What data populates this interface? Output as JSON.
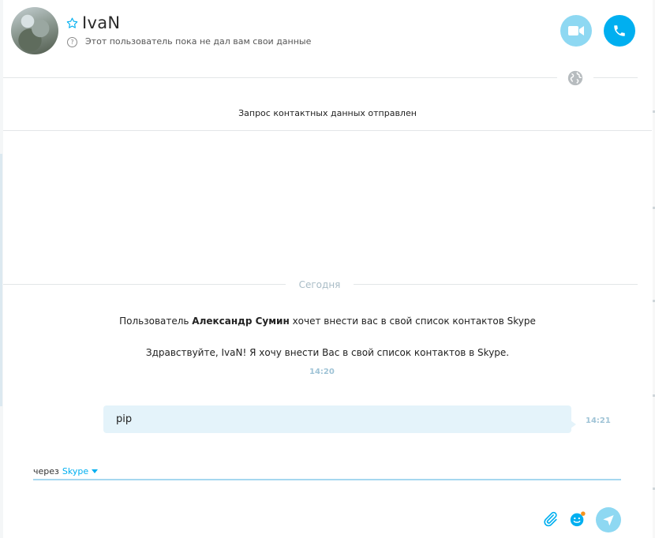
{
  "header": {
    "contact_name": "IvaN",
    "status_text": "Этот пользователь пока не дал вам свои данные",
    "help_glyph": "?"
  },
  "request_notice": "Запрос контактных данных отправлен",
  "date_divider": "Сегодня",
  "system_messages": {
    "request_prefix": "Пользователь ",
    "request_sender": "Александр Сумин",
    "request_suffix": " хочет внести вас в свой список контактов Skype",
    "greeting": "Здравствуйте, IvaN! Я хочу внести Вас в свой список контактов в Skype.",
    "time": "14:20"
  },
  "message": {
    "text": "pip",
    "time": "14:21"
  },
  "compose": {
    "via_label": "через",
    "via_service": "Skype"
  },
  "colors": {
    "accent": "#00aff0",
    "accent_light": "#8ed8f2",
    "bubble": "#e4f3fa",
    "time_label": "#9fc3d6"
  },
  "icons": [
    "star-icon",
    "help-icon",
    "video-camera-icon",
    "phone-icon",
    "globe-icon",
    "chevron-down-icon",
    "paperclip-icon",
    "emoji-icon",
    "send-icon"
  ]
}
